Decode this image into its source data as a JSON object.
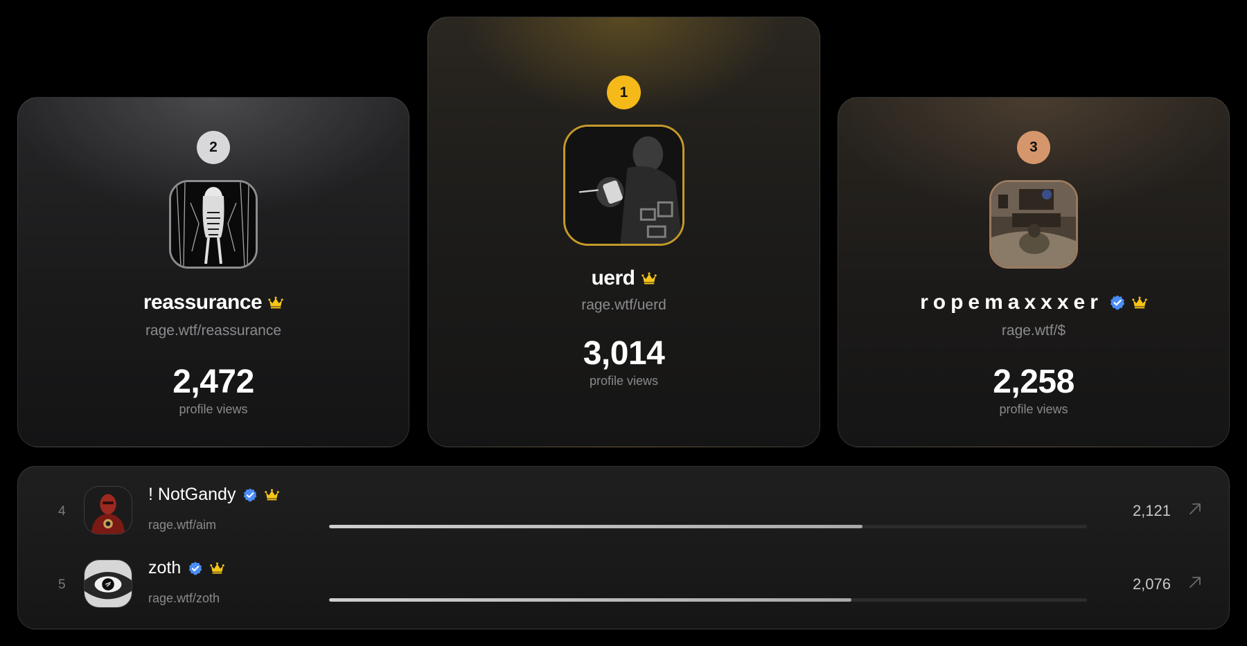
{
  "colors": {
    "gold": "#f5b919",
    "silver": "#d8d8da",
    "bronze": "#d6966c",
    "verified": "#4a8df6",
    "crown": "#f5c518",
    "muted": "#8a8a8c"
  },
  "podium": {
    "first": {
      "rank": "1",
      "name": "uerd",
      "handle": "rage.wtf/uerd",
      "views": "3,014",
      "views_label": "profile views",
      "verified": false,
      "crown": true
    },
    "second": {
      "rank": "2",
      "name": "reassurance",
      "handle": "rage.wtf/reassurance",
      "views": "2,472",
      "views_label": "profile views",
      "verified": false,
      "crown": true
    },
    "third": {
      "rank": "3",
      "name": "ropemaxxxer",
      "handle": "rage.wtf/$",
      "views": "2,258",
      "views_label": "profile views",
      "verified": true,
      "crown": true
    }
  },
  "list": [
    {
      "rank": "4",
      "name": "! NotGandy",
      "handle": "rage.wtf/aim",
      "views": "2,121",
      "progress": 0.704,
      "verified": true,
      "crown": true,
      "icon": "arrow-up-right-icon"
    },
    {
      "rank": "5",
      "name": "zoth",
      "handle": "rage.wtf/zoth",
      "views": "2,076",
      "progress": 0.689,
      "verified": true,
      "crown": true,
      "icon": "arrow-up-right-icon"
    }
  ]
}
